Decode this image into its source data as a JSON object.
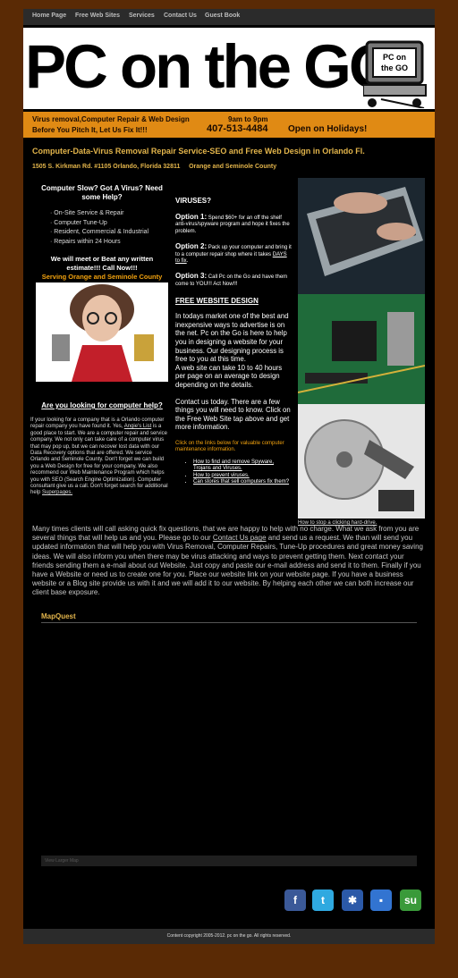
{
  "nav": [
    "Home Page",
    "Free Web Sites",
    "Services",
    "Contact Us",
    "Guest Book"
  ],
  "banner": {
    "logo": "PC on the GO",
    "mascot": "PC on the GO"
  },
  "strip": {
    "line1": "Virus removal,Computer Repair & Web Design",
    "hours": "9am to 9pm",
    "line2": "Before You Pitch It, Let Us Fix It!!!",
    "phone": "407-513-4484",
    "holidays": "Open on Holidays!"
  },
  "heading": "Computer-Data-Virus Removal Repair Service-SEO and Free Web Design in Orlando Fl.",
  "address": "1505 S. Kirkman Rd. #1105 Orlando, Florida 32811",
  "county": "Orange and Seminole County",
  "left": {
    "title": "Computer Slow? Got A Virus? Need some Help?",
    "services": [
      "On-Site Service & Repair",
      "Computer Tune-Up",
      "Resident, Commercial & Industrial",
      "Repairs within 24 Hours"
    ],
    "meet": "We will meet or Beat any written estimate!!! Call Now!!!",
    "serving": "Serving Orange and Seminole County",
    "looking": "Are you looking for computer help?",
    "body1": "If your looking for a company that is a Orlando computer repair company you have found it. Yes,",
    "link1": "Angie's List",
    "body2": "is a good place to start. We are a computer repair and service company. We not only can take care of a computer virus that may pop up, but we can recover lost data with our Data Recovery options that are offered. We service Orlando and Seminole County. Don't forget we can build you a Web Design for free for your company. We also recommend our Web Maintenance Program which helps you with SEO (Search Engine Optimization). Computer consultant give us a call. Don't forget search for additional help",
    "link2": "Superpages."
  },
  "mid": {
    "viruses": "VIRUSES?",
    "opt1_label": "Option 1:",
    "opt1": "Spend $60+ for an off the shelf anti-virus/spyware program and hope it fixes the problem.",
    "opt2_label": "Option 2:",
    "opt2": "Pack up your computer and bring it to a computer repair shop where it takes",
    "opt2_link": "DAYS to fix",
    "opt3_label": "Option 3:",
    "opt3": "Call Pc on the Go and have them come to YOU!!! Act Now!!!",
    "free_title": "FREE WEBSITE DESIGN",
    "free1": "In todays market one of the best and inexpensive ways to advertise is on the net. Pc on the Go is here to help you in designing a website for your business. Our designing process is free to you at this time.",
    "free2": "A web site can take 10 to 40 hours per page on an average to design depending on the details.",
    "contact": "Contact us today. There are a few things you will need to know. Click on the Free Web Site tap above and get more information.",
    "click": "Click on the links below for valuable computer maintenance information.",
    "links": [
      "How to find and remove Spyware, Trojans and Viruses.",
      "How to prevent viruses.",
      "Can stores that sell computers fix them?"
    ]
  },
  "caption": "How to stop a clicking hard-drive.",
  "para_pre": "Many times clients will call asking quick fix questions, that we are happy to help with no charge. What we ask from you are several things that will help us and you.  Please go to our",
  "para_link": "Contact Us page",
  "para_post": "and send us a request. We than will send you updated information that will help you with Virus Removal, Computer Repairs, Tune-Up procedures and great money saving ideas. We will also inform you when there may be virus attacking and ways to prevent getting them. Next contact your friends sending them a e-mail about out Website. Just copy and paste our e-mail address and send it to them. Finally if you have a Website or need us to create one for you. Place our website link on your website page. If you have a business website or a Blog site provide us with it and we will add it to our website. By helping each other we can both increase our client base exposure.",
  "mapquest": "MapQuest",
  "mapbar": "View Larger Map",
  "social": [
    {
      "name": "facebook-icon",
      "glyph": "f",
      "color": "#3b5998"
    },
    {
      "name": "twitter-icon",
      "glyph": "t",
      "color": "#2fa9e0"
    },
    {
      "name": "myspace-icon",
      "glyph": "✱",
      "color": "#2b59a8"
    },
    {
      "name": "delicious-icon",
      "glyph": "▪",
      "color": "#3274d1"
    },
    {
      "name": "stumbleupon-icon",
      "glyph": "su",
      "color": "#3a9a3a"
    }
  ],
  "footer": "Content copyright 2005-2012. pc on the go. All rights reserved."
}
